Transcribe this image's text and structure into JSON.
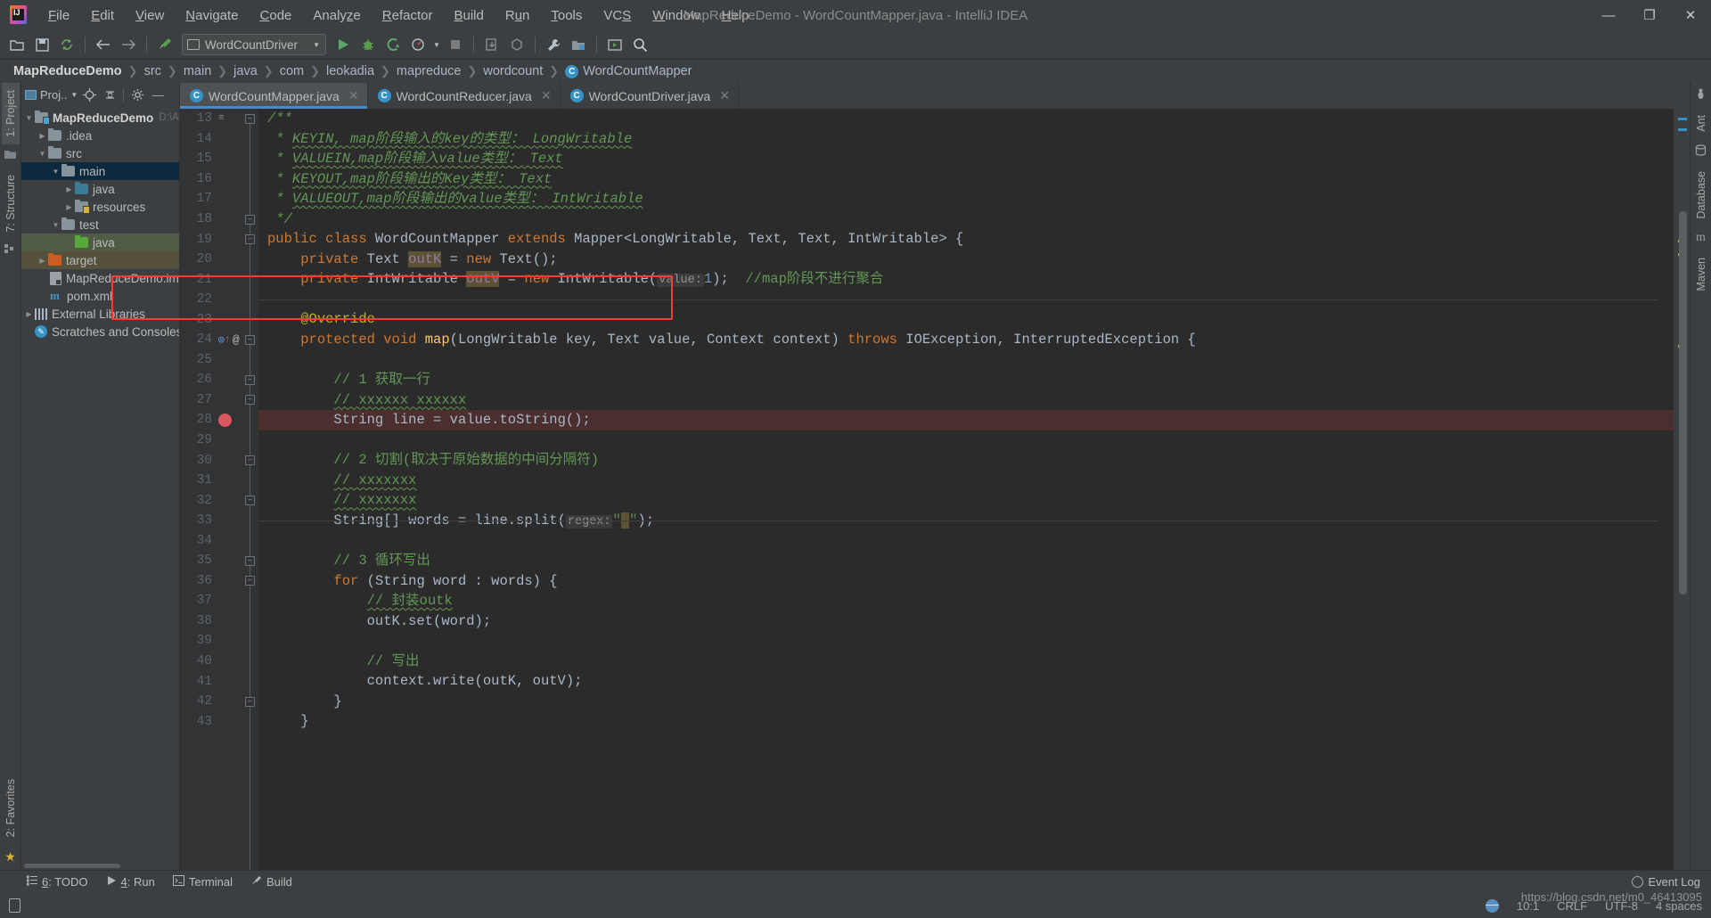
{
  "window": {
    "title": "MapReduceDemo - WordCountMapper.java - IntelliJ IDEA",
    "minimize": "—",
    "maximize": "❐",
    "close": "✕",
    "logo_text": "IJ"
  },
  "menubar": {
    "items": [
      {
        "label": "File",
        "mnemonic": "F"
      },
      {
        "label": "Edit",
        "mnemonic": "E"
      },
      {
        "label": "View",
        "mnemonic": "V"
      },
      {
        "label": "Navigate",
        "mnemonic": "N"
      },
      {
        "label": "Code",
        "mnemonic": "C"
      },
      {
        "label": "Analyze",
        "mnemonic": "z"
      },
      {
        "label": "Refactor",
        "mnemonic": "R"
      },
      {
        "label": "Build",
        "mnemonic": "B"
      },
      {
        "label": "Run",
        "mnemonic": "u"
      },
      {
        "label": "Tools",
        "mnemonic": "T"
      },
      {
        "label": "VCS",
        "mnemonic": "S"
      },
      {
        "label": "Window",
        "mnemonic": "W"
      },
      {
        "label": "Help",
        "mnemonic": "H"
      }
    ]
  },
  "toolbar": {
    "open_icon": "open-folder-icon",
    "save_icon": "save-icon",
    "sync_icon": "sync-icon",
    "back_icon": "back-arrow-icon",
    "forward_icon": "forward-arrow-icon",
    "build_icon": "hammer-icon",
    "run_config_name": "WordCountDriver",
    "run_icon": "run-icon",
    "debug_icon": "debug-icon",
    "coverage_icon": "run-with-coverage-icon",
    "profile_icon": "profile-icon",
    "stop_icon": "stop-icon",
    "update_icon": "update-project-icon",
    "commit_icon": "commit-icon",
    "settings_icon": "wrench-settings-icon",
    "project-structure_icon": "project-structure-icon",
    "select-in_icon": "select-in-icon",
    "search_icon": "search-icon"
  },
  "breadcrumb": {
    "items": [
      "MapReduceDemo",
      "src",
      "main",
      "java",
      "com",
      "leokadia",
      "mapreduce",
      "wordcount"
    ],
    "class_badge": "C",
    "class_name": "WordCountMapper"
  },
  "rail_left": {
    "project_tab": "1: Project",
    "structure_tab": "7: Structure",
    "favorites_tab": "2: Favorites",
    "project_mnemonic": "1",
    "structure_mnemonic": "7",
    "favorites_mnemonic": "2"
  },
  "rail_right": {
    "ant_tab": "Ant",
    "database_tab": "Database",
    "maven_tab": "Maven"
  },
  "project_panel": {
    "title": "Proj..",
    "locate_icon": "locate-target-icon",
    "collapse_icon": "collapse-all-icon",
    "settings_icon": "gear-icon",
    "hide_icon": "hide-panel-icon",
    "tree": [
      {
        "label": "MapReduceDemo",
        "path": "D:\\A",
        "indent": 0,
        "arrow": "▼",
        "icon": "folder-module",
        "bold": true,
        "sel": ""
      },
      {
        "label": ".idea",
        "indent": 1,
        "arrow": "▶",
        "icon": "folder",
        "sel": ""
      },
      {
        "label": "src",
        "indent": 1,
        "arrow": "▼",
        "icon": "folder",
        "sel": ""
      },
      {
        "label": "main",
        "indent": 2,
        "arrow": "▼",
        "icon": "folder",
        "sel": "sel-blue"
      },
      {
        "label": "java",
        "indent": 3,
        "arrow": "▶",
        "icon": "folder-blue",
        "sel": ""
      },
      {
        "label": "resources",
        "indent": 3,
        "arrow": "▶",
        "icon": "folder-res",
        "sel": ""
      },
      {
        "label": "test",
        "indent": 2,
        "arrow": "▼",
        "icon": "folder",
        "sel": ""
      },
      {
        "label": "java",
        "indent": 3,
        "arrow": "",
        "icon": "folder-green",
        "sel": "sel-green"
      },
      {
        "label": "target",
        "indent": 1,
        "arrow": "▶",
        "icon": "folder-orange",
        "sel": "sel-olive"
      },
      {
        "label": "MapReduceDemo.iml",
        "indent": 2,
        "arrow": "",
        "icon": "file",
        "sel": ""
      },
      {
        "label": "pom.xml",
        "indent": 1,
        "arrow": "",
        "icon": "maven",
        "sel": ""
      },
      {
        "label": "External Libraries",
        "indent": 0,
        "arrow": "▶",
        "icon": "library",
        "sel": ""
      },
      {
        "label": "Scratches and Consoles",
        "indent": 0,
        "arrow": "",
        "icon": "scratch",
        "sel": ""
      }
    ]
  },
  "tabs": [
    {
      "label": "WordCountMapper.java",
      "badge": "C",
      "active": true,
      "close": "✕"
    },
    {
      "label": "WordCountReducer.java",
      "badge": "C",
      "active": false,
      "close": "✕"
    },
    {
      "label": "WordCountDriver.java",
      "badge": "C",
      "active": false,
      "close": "✕"
    }
  ],
  "editor": {
    "first_line": 13,
    "breakpoint_line": 28,
    "override_marker_line": 24,
    "lines": [
      {
        "n": 13,
        "indent": 0
      },
      {
        "n": 14,
        "indent": 0
      },
      {
        "n": 15,
        "indent": 0
      },
      {
        "n": 16,
        "indent": 0
      },
      {
        "n": 17,
        "indent": 0
      },
      {
        "n": 18,
        "indent": 0
      },
      {
        "n": 19,
        "indent": 0
      },
      {
        "n": 20,
        "indent": 0
      },
      {
        "n": 21,
        "indent": 0
      },
      {
        "n": 22,
        "indent": 0
      },
      {
        "n": 23,
        "indent": 0
      },
      {
        "n": 24,
        "indent": 0
      },
      {
        "n": 25,
        "indent": 0
      },
      {
        "n": 26,
        "indent": 0
      },
      {
        "n": 27,
        "indent": 0
      },
      {
        "n": 28,
        "indent": 0
      },
      {
        "n": 29,
        "indent": 0
      },
      {
        "n": 30,
        "indent": 0
      },
      {
        "n": 31,
        "indent": 0
      },
      {
        "n": 32,
        "indent": 0
      },
      {
        "n": 33,
        "indent": 0
      },
      {
        "n": 34,
        "indent": 0
      },
      {
        "n": 35,
        "indent": 0
      },
      {
        "n": 36,
        "indent": 0
      },
      {
        "n": 37,
        "indent": 0
      },
      {
        "n": 38,
        "indent": 0
      },
      {
        "n": 39,
        "indent": 0
      },
      {
        "n": 40,
        "indent": 0
      },
      {
        "n": 41,
        "indent": 0
      },
      {
        "n": 42,
        "indent": 0
      },
      {
        "n": 43,
        "indent": 0
      }
    ],
    "code_text": {
      "l13": "/**",
      "l14_a": " * ",
      "l14_b": "KEYIN, map阶段输入的key的类型： LongWritable",
      "l15_b": "VALUEIN,map阶段输入value类型： Text",
      "l16_b": "KEYOUT,map阶段输出的Key类型： Text",
      "l17_b": "VALUEOUT,map阶段输出的value类型： IntWritable",
      "l18": " */",
      "l19_k1": "public class ",
      "l19_n": "WordCountMapper ",
      "l19_k2": "extends ",
      "l19_rest": "Mapper<LongWritable, Text, Text, IntWritable> {",
      "l20_k": "private ",
      "l20_t": "Text ",
      "l20_f": "outK",
      "l20_eq": " = ",
      "l20_new": "new ",
      "l20_rest": "Text();",
      "l21_k": "private ",
      "l21_t": "IntWritable ",
      "l21_f": "outV",
      "l21_eq": " = ",
      "l21_new": "new ",
      "l21_call": "IntWritable(",
      "l21_hint": "value:",
      "l21_num": "1",
      "l21_end": ");",
      "l21_cmt": "//map阶段不进行聚合",
      "l23_ann": "@Override",
      "l24_k1": "protected ",
      "l24_k2": "void ",
      "l24_m": "map",
      "l24_p": "(LongWritable key, Text value, Context context) ",
      "l24_k3": "throws ",
      "l24_rest": "IOException, InterruptedException {",
      "l26": "// 1 获取一行",
      "l27": "// xxxxxx xxxxxx",
      "l28_t": "String ",
      "l28_rest": "line = value.toString();",
      "l30": "// 2 切割(取决于原始数据的中间分隔符)",
      "l31": "// xxxxxxx",
      "l32": "// xxxxxxx",
      "l33_t": "String[] ",
      "l33_a": "words = line.split(",
      "l33_hint": "regex:",
      "l33_str": "\" \"",
      "l33_end": ");",
      "l35": "// 3 循环写出",
      "l36_k": "for ",
      "l36_rest": "(String word : words) {",
      "l37": "// 封装outk",
      "l38": "outK.set(word);",
      "l40": "// 写出",
      "l41": "context.write(outK, outV);",
      "l42": "}",
      "l43": "}"
    }
  },
  "bottom_bar": {
    "items": [
      {
        "label": "6: TODO",
        "mnemonic": "6",
        "icon": "todo-list-icon"
      },
      {
        "label": "4: Run",
        "mnemonic": "4",
        "icon": "run-icon"
      },
      {
        "label": "Terminal",
        "mnemonic": "",
        "icon": "terminal-icon"
      },
      {
        "label": "Build",
        "mnemonic": "",
        "icon": "hammer-icon"
      }
    ]
  },
  "statusbar": {
    "caret_position": "10:1",
    "line_separator": "CRLF",
    "encoding": "UTF-8",
    "indent": "4 spaces",
    "event_log": "Event Log",
    "watermark": "https://blog.csdn.net/m0_46413095"
  },
  "colors": {
    "accent": "#4a88c7",
    "breakpoint": "#db5860",
    "highlight_box": "#ff3b30",
    "comment": "#629755",
    "keyword": "#cc7832",
    "string": "#6a8759",
    "field": "#9876aa",
    "method": "#ffc66d",
    "annotation": "#bbb529",
    "background": "#2b2b2b",
    "chrome": "#3c3f41"
  }
}
